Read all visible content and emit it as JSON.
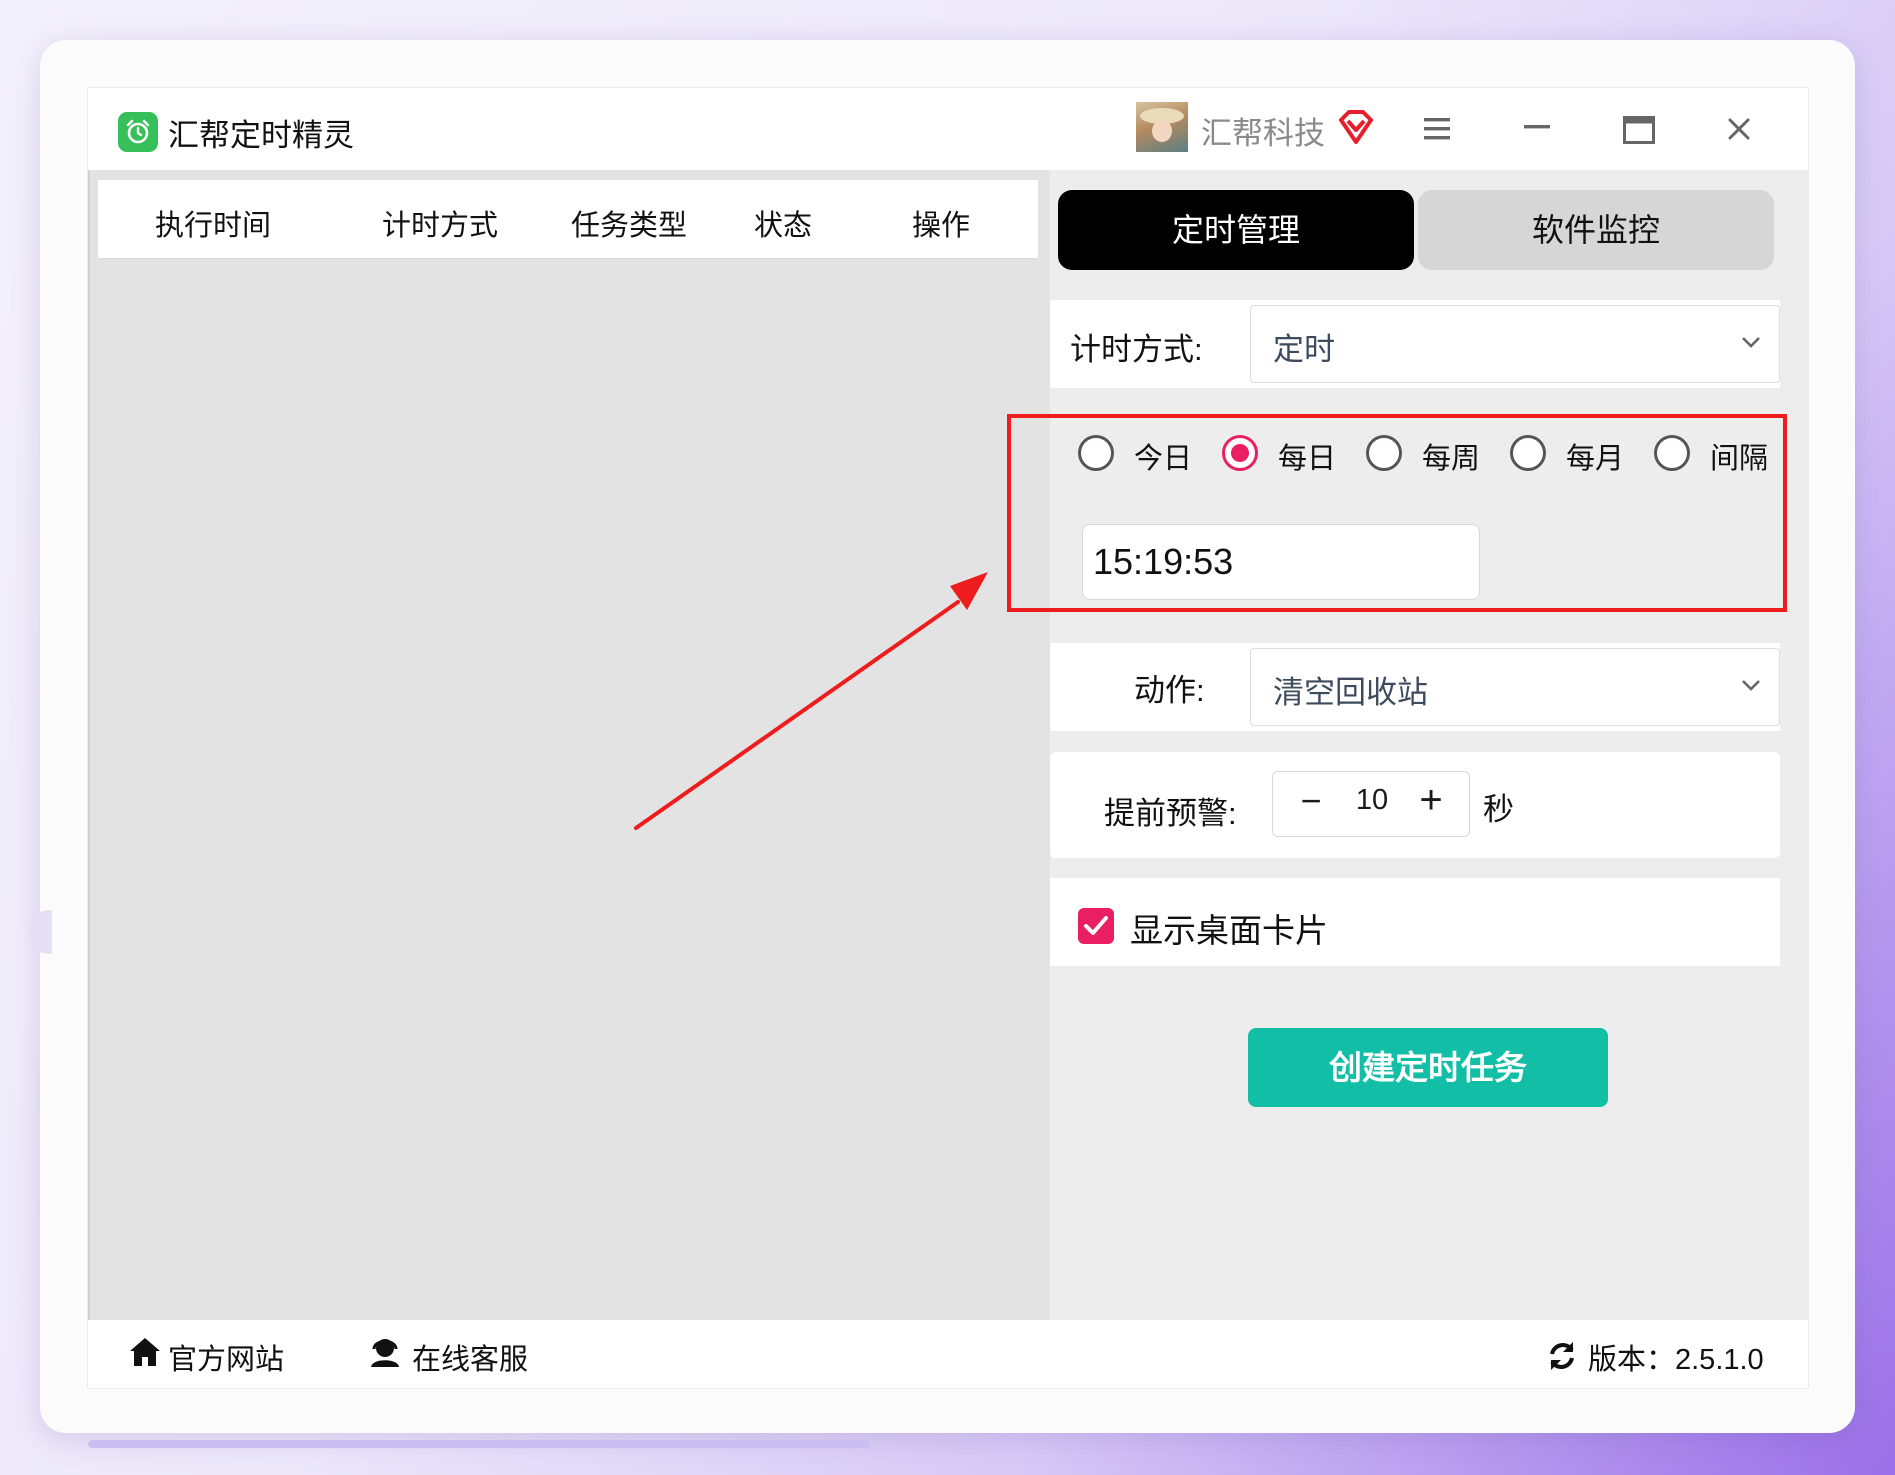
{
  "app": {
    "title": "汇帮定时精灵"
  },
  "user": {
    "name": "汇帮科技"
  },
  "table": {
    "columns": [
      "执行时间",
      "计时方式",
      "任务类型",
      "状态",
      "操作"
    ]
  },
  "tabs": {
    "active": "定时管理",
    "inactive": "软件监控"
  },
  "timing_mode": {
    "label": "计时方式:",
    "value": "定时"
  },
  "schedule": {
    "options": [
      "今日",
      "每日",
      "每周",
      "每月",
      "间隔"
    ],
    "selected": "每日",
    "time": "15:19:53"
  },
  "action": {
    "label": "动作:",
    "value": "清空回收站"
  },
  "advance_warning": {
    "label": "提前预警:",
    "minus": "−",
    "value": "10",
    "plus": "+",
    "unit": "秒"
  },
  "desktop_card": {
    "label": "显示桌面卡片",
    "checked": true
  },
  "create_button": {
    "label": "创建定时任务"
  },
  "footer": {
    "website": "官方网站",
    "support": "在线客服",
    "version": "版本：2.5.1.0"
  },
  "colors": {
    "accent_pink": "#e91e63",
    "create_teal": "#12bfa6",
    "highlight_red": "#ee1c1c",
    "logo_green": "#35c05a"
  }
}
